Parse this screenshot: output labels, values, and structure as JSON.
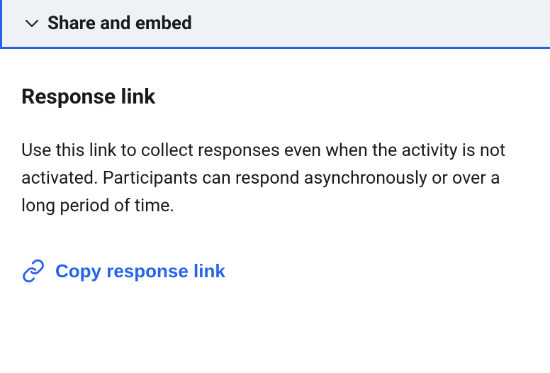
{
  "accordion": {
    "title": "Share and embed"
  },
  "section": {
    "title": "Response link",
    "description": "Use this link to collect responses even when the activity is not activated. Participants can respond asynchronously or over a long period of time.",
    "copy_button_label": "Copy response link"
  }
}
